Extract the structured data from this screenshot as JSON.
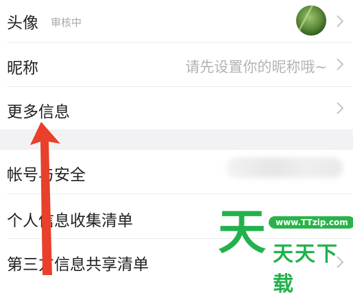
{
  "rows": {
    "avatar": {
      "label": "头像",
      "status": "审核中",
      "icon": "avatar-image"
    },
    "nickname": {
      "label": "昵称",
      "value": "请先设置你的昵称哦~"
    },
    "more_info": {
      "label": "更多信息"
    },
    "account_security": {
      "label": "帐号与安全"
    },
    "personal_info_list": {
      "label": "个人信息收集清单"
    },
    "third_party_list": {
      "label": "第三方信息共享清单"
    }
  },
  "watermark": {
    "char": "天",
    "url": "www.TTzip.com",
    "name": "天天下载"
  },
  "colors": {
    "arrow": "#e8402b",
    "watermark": "#22b14c",
    "section_gap": "#f2f2f4"
  }
}
